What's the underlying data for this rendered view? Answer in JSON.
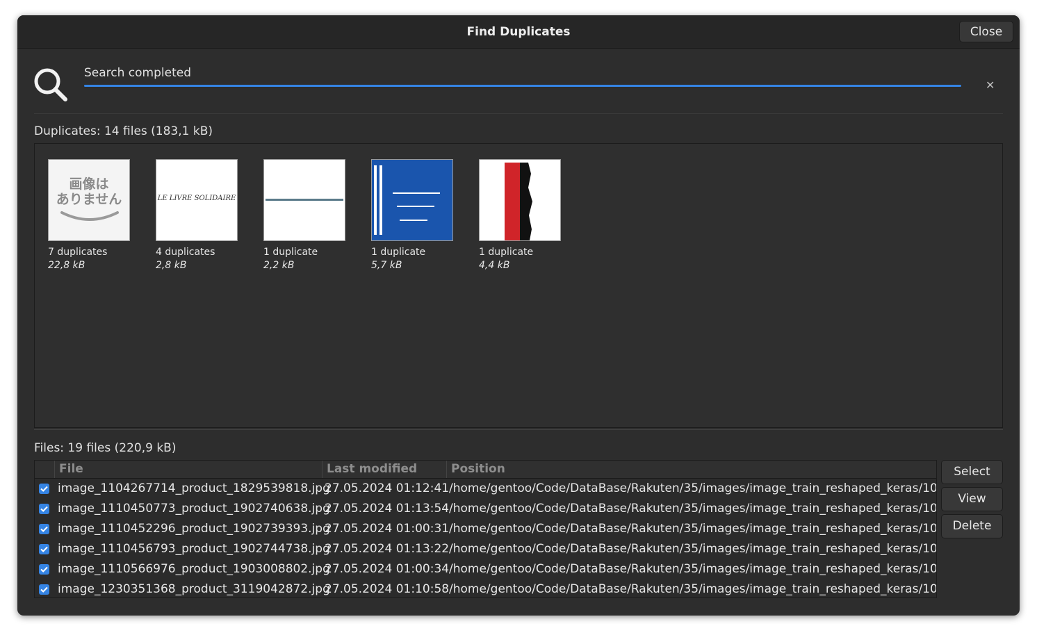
{
  "window": {
    "title": "Find Duplicates",
    "close_label": "Close"
  },
  "search": {
    "status": "Search completed",
    "progress": 1.0
  },
  "duplicates": {
    "heading": "Duplicates: 14 files (183,1 kB)",
    "items": [
      {
        "count": "7 duplicates",
        "size": "22,8 kB",
        "thumb_text_line1": "画像は",
        "thumb_text_line2": "ありません"
      },
      {
        "count": "4 duplicates",
        "size": "2,8 kB",
        "thumb_text": "LE LIVRE SOLIDAIRE"
      },
      {
        "count": "1 duplicate",
        "size": "2,2 kB"
      },
      {
        "count": "1 duplicate",
        "size": "5,7 kB"
      },
      {
        "count": "1 duplicate",
        "size": "4,4 kB"
      }
    ]
  },
  "files": {
    "heading": "Files: 19 files (220,9 kB)",
    "columns": [
      "File",
      "Last modified",
      "Position"
    ],
    "rows": [
      {
        "file": "image_1104267714_product_1829539818.jpg",
        "modified": "27.05.2024 01:12:41",
        "position": "/home/gentoo/Code/DataBase/Rakuten/35/images/image_train_reshaped_keras/10"
      },
      {
        "file": "image_1110450773_product_1902740638.jpg",
        "modified": "27.05.2024 01:13:54",
        "position": "/home/gentoo/Code/DataBase/Rakuten/35/images/image_train_reshaped_keras/10"
      },
      {
        "file": "image_1110452296_product_1902739393.jpg",
        "modified": "27.05.2024 01:00:31",
        "position": "/home/gentoo/Code/DataBase/Rakuten/35/images/image_train_reshaped_keras/10"
      },
      {
        "file": "image_1110456793_product_1902744738.jpg",
        "modified": "27.05.2024 01:13:22",
        "position": "/home/gentoo/Code/DataBase/Rakuten/35/images/image_train_reshaped_keras/10"
      },
      {
        "file": "image_1110566976_product_1903008802.jpg",
        "modified": "27.05.2024 01:00:34",
        "position": "/home/gentoo/Code/DataBase/Rakuten/35/images/image_train_reshaped_keras/10"
      },
      {
        "file": "image_1230351368_product_3119042872.jpg",
        "modified": "27.05.2024 01:10:58",
        "position": "/home/gentoo/Code/DataBase/Rakuten/35/images/image_train_reshaped_keras/10"
      }
    ]
  },
  "actions": {
    "select": "Select",
    "view": "View",
    "delete": "Delete"
  },
  "colors": {
    "accent": "#3584e4",
    "window_bg": "#2d2d2d",
    "titlebar_bg": "#262626"
  },
  "icons": {
    "search": "search-icon",
    "dismiss": "close-icon",
    "checkbox": "checkbox-checked-icon"
  }
}
